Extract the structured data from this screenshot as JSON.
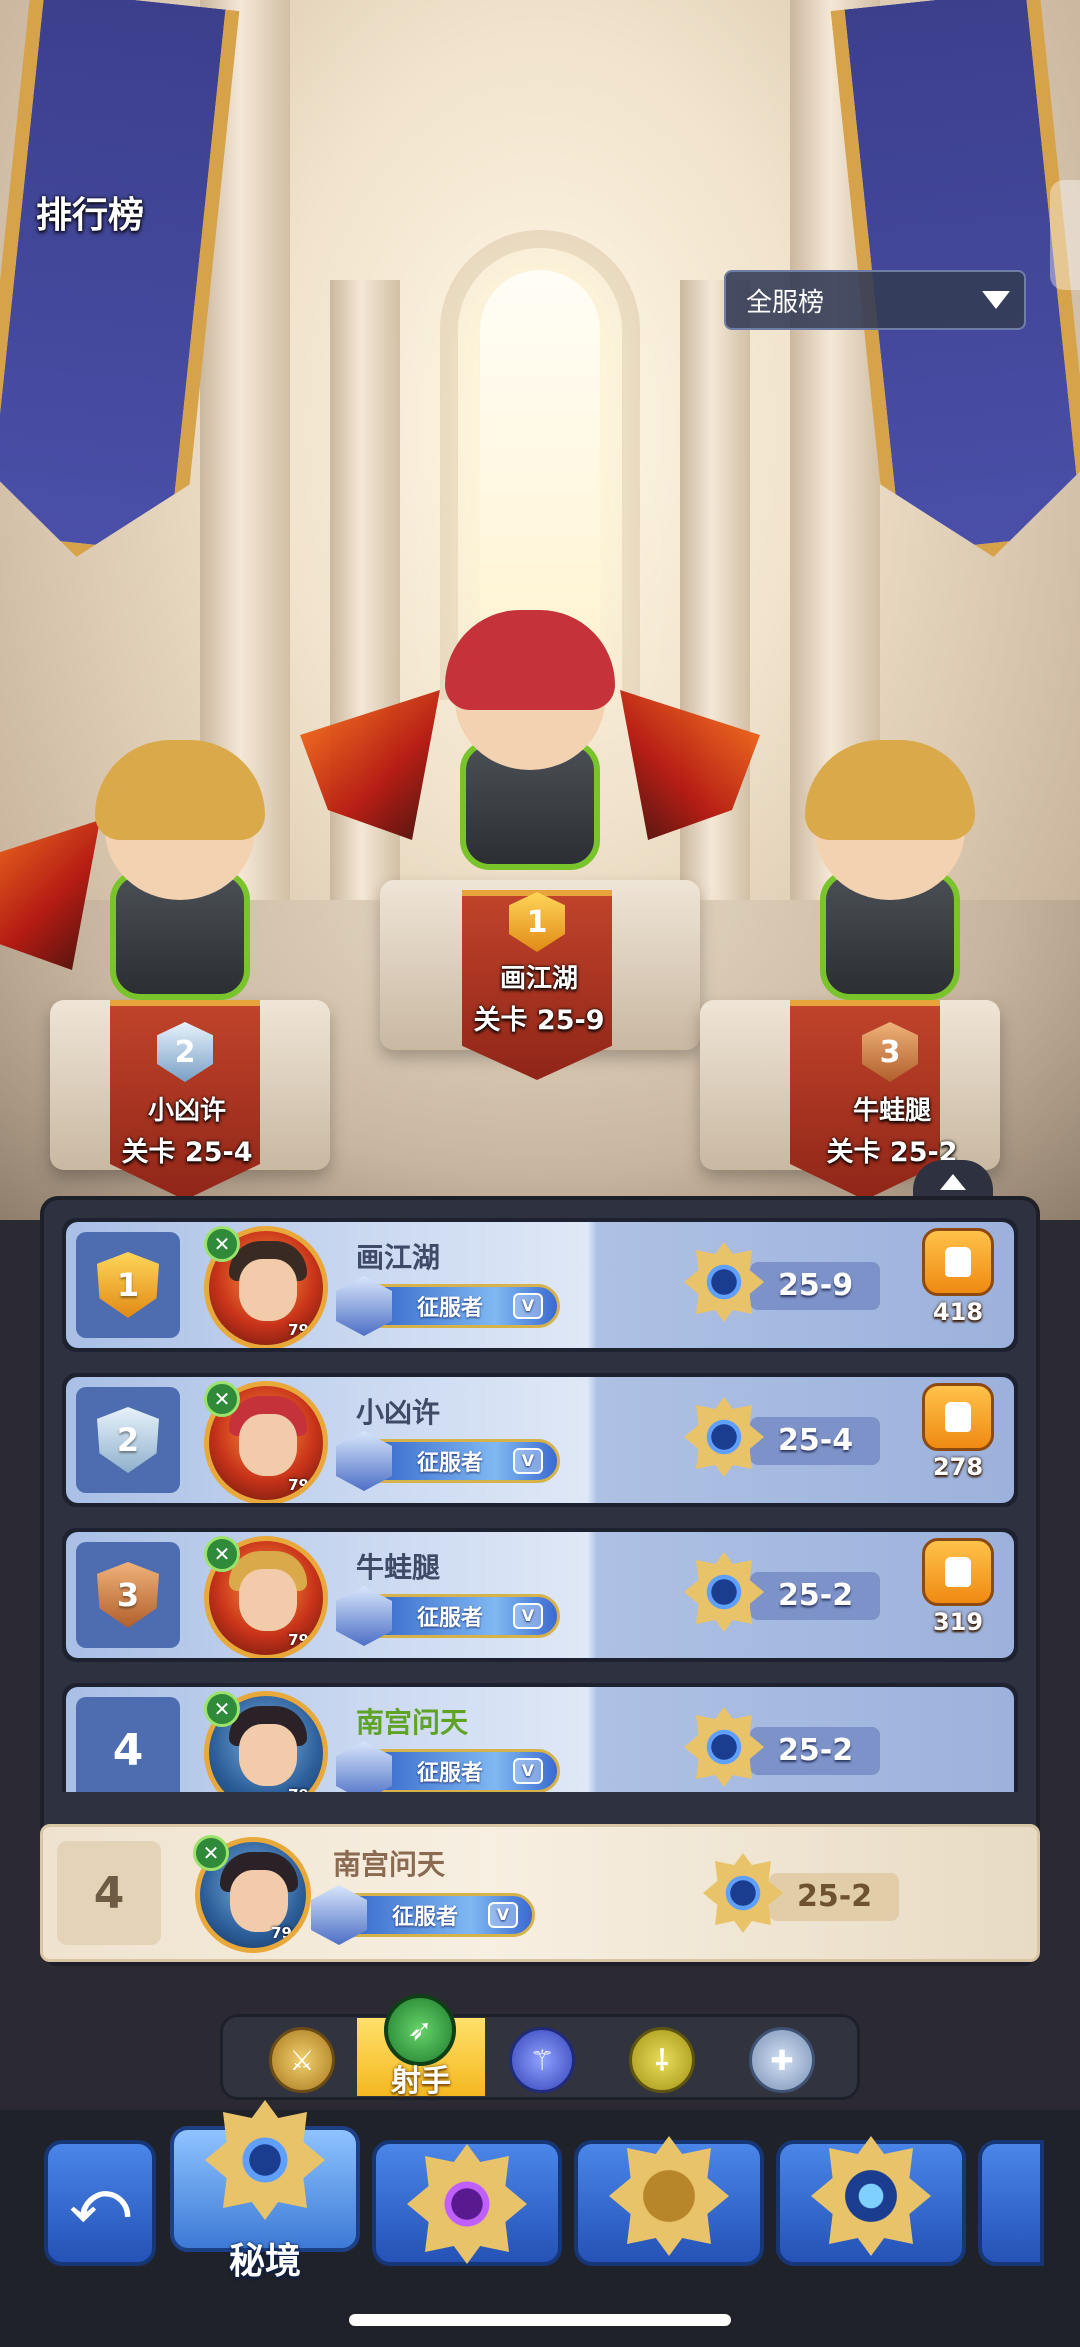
{
  "header": {
    "title": "排行榜",
    "server_filter": "全服榜"
  },
  "podium": [
    {
      "rank": "1",
      "name": "画江湖",
      "stage": "关卡 25-9"
    },
    {
      "rank": "2",
      "name": "小凶许",
      "stage": "关卡 25-4"
    },
    {
      "rank": "3",
      "name": "牛蛙腿",
      "stage": "关卡 25-2"
    }
  ],
  "ranking": {
    "rows": [
      {
        "rank": "1",
        "name": "画江湖",
        "level": "79",
        "title": "征服者",
        "title_tier": "V",
        "stage": "25-9",
        "likes": "418"
      },
      {
        "rank": "2",
        "name": "小凶许",
        "level": "79",
        "title": "征服者",
        "title_tier": "V",
        "stage": "25-4",
        "likes": "278"
      },
      {
        "rank": "3",
        "name": "牛蛙腿",
        "level": "79",
        "title": "征服者",
        "title_tier": "V",
        "stage": "25-2",
        "likes": "319"
      },
      {
        "rank": "4",
        "name": "南宫问天",
        "level": "79",
        "title": "征服者",
        "title_tier": "V",
        "stage": "25-2"
      }
    ],
    "my_row": {
      "rank": "4",
      "name": "南宫问天",
      "level": "79",
      "title": "征服者",
      "title_tier": "V",
      "stage": "25-2"
    }
  },
  "class_filter": {
    "selected_label": "射手",
    "icons": [
      "axe-icon",
      "bow-icon",
      "staff-icon",
      "dagger-icon",
      "cross-icon"
    ]
  },
  "bottom_nav": {
    "back_glyph": "⤺",
    "active_label": "秘境"
  },
  "colors": {
    "accent_blue": "#2552b6",
    "gold": "#e08a16",
    "archer_green": "#1f7a2c",
    "my_name": "#5fa326"
  }
}
